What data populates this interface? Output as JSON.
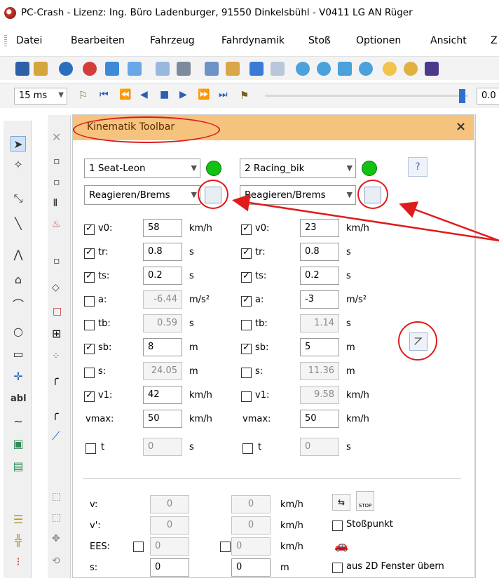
{
  "window": {
    "title": "PC-Crash - Lizenz: Ing. Büro Ladenburger, 91550 Dinkelsbühl - V0411 LG AN Rüger"
  },
  "menu": [
    "Datei",
    "Bearbeiten",
    "Fahrzeug",
    "Fahrdynamik",
    "Stoß",
    "Optionen",
    "Ansicht",
    "Z"
  ],
  "toolbar2": {
    "time_step": "15 ms",
    "right_value": "0.0"
  },
  "panel": {
    "title": "Kinematik Toolbar",
    "close": "×",
    "vehicle1": {
      "name": "1 Seat-Leon",
      "mode": "Reagieren/Brems",
      "rows": [
        {
          "label": "v0:",
          "checked": true,
          "value": "58",
          "unit": "km/h",
          "enabled": true
        },
        {
          "label": "tr:",
          "checked": true,
          "value": "0.8",
          "unit": "s",
          "enabled": true
        },
        {
          "label": "ts:",
          "checked": true,
          "value": "0.2",
          "unit": "s",
          "enabled": true
        },
        {
          "label": "a:",
          "checked": false,
          "value": "-6.44",
          "unit": "m/s²",
          "enabled": false
        },
        {
          "label": "tb:",
          "checked": false,
          "value": "0.59",
          "unit": "s",
          "enabled": false
        },
        {
          "label": "sb:",
          "checked": true,
          "value": "8",
          "unit": "m",
          "enabled": true
        },
        {
          "label": "s:",
          "checked": false,
          "value": "24.05",
          "unit": "m",
          "enabled": false
        },
        {
          "label": "v1:",
          "checked": true,
          "value": "42",
          "unit": "km/h",
          "enabled": true
        }
      ],
      "vmax_label": "vmax:",
      "vmax": "50",
      "vmax_unit": "km/h",
      "t_label": "t",
      "t_value": "0",
      "t_unit": "s"
    },
    "vehicle2": {
      "name": "2 Racing_bik",
      "mode": "Reagieren/Brems",
      "rows": [
        {
          "label": "v0:",
          "checked": true,
          "value": "23",
          "unit": "km/h",
          "enabled": true
        },
        {
          "label": "tr:",
          "checked": true,
          "value": "0.8",
          "unit": "s",
          "enabled": true
        },
        {
          "label": "ts:",
          "checked": true,
          "value": "0.2",
          "unit": "s",
          "enabled": true
        },
        {
          "label": "a:",
          "checked": true,
          "value": "-3",
          "unit": "m/s²",
          "enabled": true
        },
        {
          "label": "tb:",
          "checked": false,
          "value": "1.14",
          "unit": "s",
          "enabled": false
        },
        {
          "label": "sb:",
          "checked": true,
          "value": "5",
          "unit": "m",
          "enabled": true
        },
        {
          "label": "s:",
          "checked": false,
          "value": "11.36",
          "unit": "m",
          "enabled": false
        },
        {
          "label": "v1:",
          "checked": false,
          "value": "9.58",
          "unit": "km/h",
          "enabled": false
        }
      ],
      "vmax_label": "vmax:",
      "vmax": "50",
      "vmax_unit": "km/h",
      "t_label": "t",
      "t_value": "0",
      "t_unit": "s"
    },
    "bottom": {
      "v_label": "v:",
      "v1": "0",
      "v2": "0",
      "v_unit": "km/h",
      "vp_label": "v':",
      "vp1": "0",
      "vp2": "0",
      "vp_unit": "km/h",
      "ees_label": "EES:",
      "ees1": "0",
      "ees2": "0",
      "ees_unit": "km/h",
      "s_label": "s:",
      "s1": "0",
      "s2": "0",
      "s_unit": "m",
      "stosspunkt": "Stoßpunkt",
      "aus2d": "aus 2D Fenster übern",
      "stop_icon_text": "STOP"
    }
  }
}
